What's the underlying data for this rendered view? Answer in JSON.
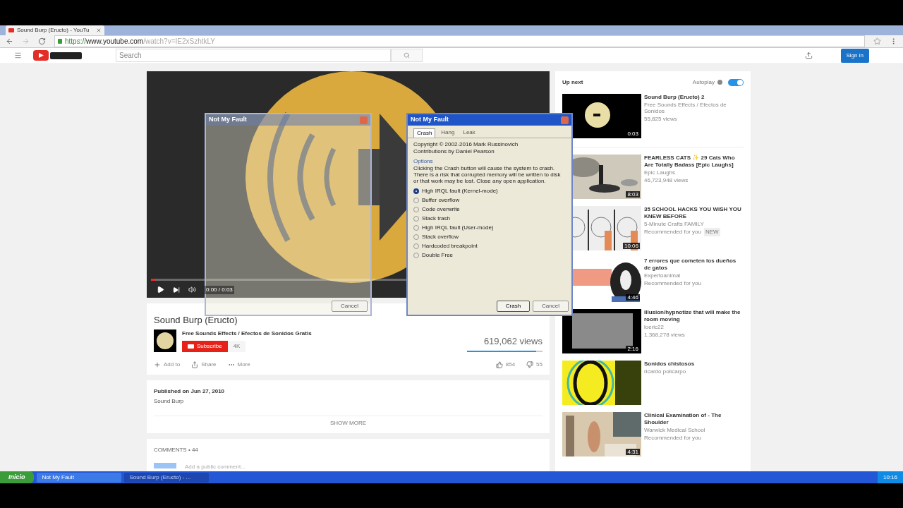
{
  "browser": {
    "tab_title": "Sound Burp (Eructo) - YouTu",
    "url": {
      "scheme": "https://",
      "host": "www.youtube.com",
      "path": "/watch?v=IE2xSzhtkLY"
    }
  },
  "header": {
    "search_placeholder": "Search",
    "sign_in": "Sign in"
  },
  "player": {
    "time": "0:00 / 0:03",
    "level": 0.01
  },
  "video": {
    "title": "Sound Burp (Eructo)",
    "channel": "Free Sounds Effects / Efectos de Sonidos Gratis",
    "subscribe": "Subscribe",
    "subscriber_count": "4K",
    "views": "619,062 views",
    "like_bar": {
      "level": 0.92
    },
    "actions": [
      "Add to",
      "Share",
      "More"
    ],
    "likes": "854",
    "dislikes": "55"
  },
  "description": {
    "published": "Published on Jun 27, 2010",
    "text": "Sound Burp",
    "show_more": "SHOW MORE"
  },
  "comments": {
    "heading": "COMMENTS • 44",
    "placeholder": "Add a public comment..."
  },
  "up_next": {
    "heading": "Up next",
    "autoplay_label": "Autoplay",
    "autoplay_on": true,
    "videos": [
      {
        "title": "Sound Burp (Eructo) 2",
        "channel": "Free Sounds Effects / Efectos de Sonidos",
        "meta": "55,825 views",
        "duration": "0:03",
        "kind": "ball"
      },
      {
        "title": "FEARLESS CATS ✨ 29 Cats Who Are Totally Badass [Epic Laughs]",
        "channel": "Epic Laughs",
        "meta": "46,723,948 views",
        "duration": "8:03",
        "kind": "cat"
      },
      {
        "title": "35 SCHOOL HACKS YOU WISH YOU KNEW BEFORE",
        "channel": "5-Minute Crafts FAMILY",
        "meta": "Recommended for you",
        "badge": "NEW",
        "duration": "10:06",
        "kind": "hands"
      },
      {
        "title": "7 errores que cometen los dueños de gatos",
        "channel": "Expertoanimal",
        "meta": "Recommended for you",
        "duration": "4:46",
        "kind": "cat2"
      },
      {
        "title": "illusion/hypnotize that will make the room moving",
        "channel": "loeric22",
        "meta": "1,368,278 views",
        "duration": "2:16",
        "kind": "grey"
      },
      {
        "title": "Sonidos chistosos",
        "channel": "ricardo policarpo",
        "kind": "speaker"
      },
      {
        "title": "Clinical Examination of - The Shoulder",
        "channel": "Warwick Medical School",
        "meta": "Recommended for you",
        "duration": "4:31",
        "kind": "room"
      }
    ]
  },
  "dialogs": [
    {
      "title": "Not My Fault",
      "active": false,
      "cancel": "Cancel"
    },
    {
      "title": "Not My Fault",
      "active": true,
      "tabs": [
        {
          "label": "Crash",
          "selected": true
        },
        {
          "label": "Hang",
          "selected": false
        },
        {
          "label": "Leak",
          "selected": false
        }
      ],
      "copyright": "Copyright © 2002-2016 Mark Russinovich",
      "contributions": "Contributions by Daniel Pearson",
      "group": "Options",
      "text": "Clicking the Crash button will cause the system to crash. There is a risk that corrupted memory will be written to disk or that work may be lost. Close any open application.",
      "options": [
        {
          "label": "High IRQL fault (Kernel-mode)",
          "selected": true
        },
        {
          "label": "Buffer overflow",
          "selected": false
        },
        {
          "label": "Code overwrite",
          "selected": false
        },
        {
          "label": "Stack trash",
          "selected": false
        },
        {
          "label": "High IRQL fault (User-mode)",
          "selected": false
        },
        {
          "label": "Stack overflow",
          "selected": false
        },
        {
          "label": "Hardcoded breakpoint",
          "selected": false
        },
        {
          "label": "Double Free",
          "selected": false
        }
      ],
      "crash": "Crash",
      "cancel": "Cancel"
    }
  ],
  "taskbar": {
    "start": "Inicio",
    "items": [
      {
        "label": "Not My Fault",
        "selected": false
      },
      {
        "label": "Sound Burp (Eructo) - ...",
        "selected": true
      }
    ],
    "clock": "10:16"
  }
}
